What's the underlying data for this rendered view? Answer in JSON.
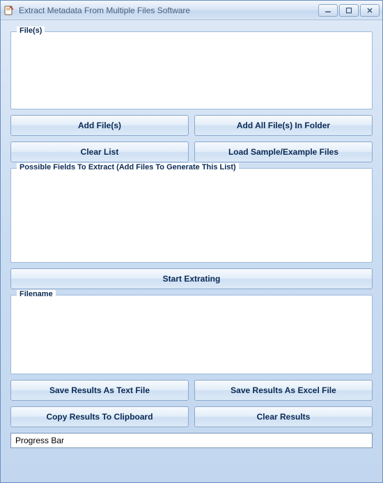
{
  "window": {
    "title": "Extract Metadata From Multiple Files Software"
  },
  "groups": {
    "files_legend": "File(s)",
    "fields_legend": "Possible Fields To Extract (Add Files To Generate This List)",
    "results_legend": "Filename"
  },
  "buttons": {
    "add_files": "Add File(s)",
    "add_all_folder": "Add All File(s) In Folder",
    "clear_list": "Clear List",
    "load_sample": "Load Sample/Example Files",
    "start": "Start Extrating",
    "save_text": "Save Results As Text File",
    "save_excel": "Save Results As Excel File",
    "copy_clipboard": "Copy Results To Clipboard",
    "clear_results": "Clear Results"
  },
  "progress": {
    "label": "Progress Bar"
  }
}
